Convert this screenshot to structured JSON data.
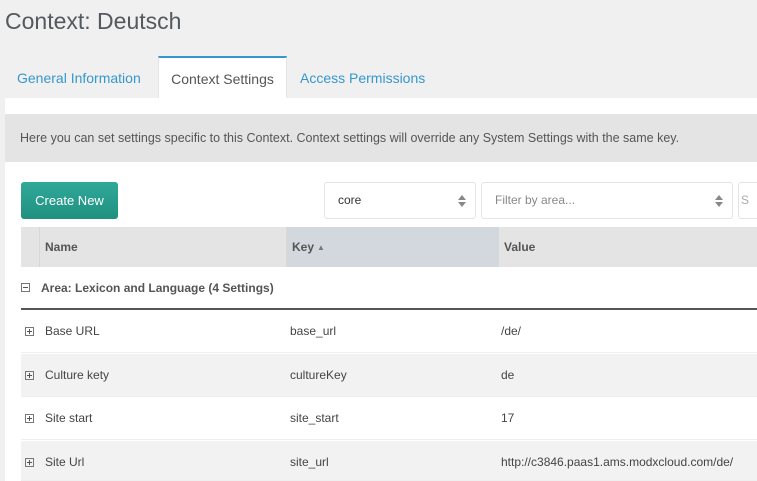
{
  "page": {
    "title": "Context: Deutsch"
  },
  "tabs": [
    {
      "label": "General Information"
    },
    {
      "label": "Context Settings"
    },
    {
      "label": "Access Permissions"
    }
  ],
  "description": "Here you can set settings specific to this Context. Context settings will override any System Settings with the same key.",
  "toolbar": {
    "create_label": "Create New",
    "namespace_value": "core",
    "area_placeholder": "Filter by area...",
    "search_placeholder": "S"
  },
  "grid": {
    "columns": {
      "name": "Name",
      "key": "Key",
      "value": "Value"
    },
    "group": {
      "label": "Area: Lexicon and Language (4 Settings)"
    },
    "rows": [
      {
        "name": "Base URL",
        "key": "base_url",
        "value": "/de/"
      },
      {
        "name": "Culture kety",
        "key": "cultureKey",
        "value": "de"
      },
      {
        "name": "Site start",
        "key": "site_start",
        "value": "17"
      },
      {
        "name": "Site Url",
        "key": "site_url",
        "value": "http://c3846.paas1.ams.modxcloud.com/de/"
      }
    ]
  },
  "colors": {
    "accent": "#3697cd",
    "button": "#2a9d8f"
  }
}
